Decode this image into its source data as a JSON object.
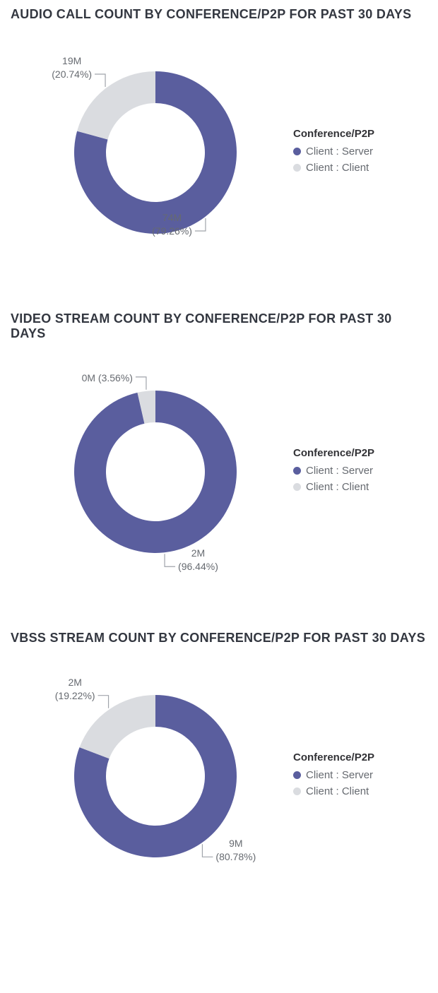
{
  "colors": {
    "primary": "#5A5E9E",
    "secondary": "#DADCE0"
  },
  "legend": {
    "title": "Conference/P2P",
    "items": [
      {
        "label": "Client : Server",
        "color_key": "primary"
      },
      {
        "label": "Client : Client",
        "color_key": "secondary"
      }
    ]
  },
  "charts": [
    {
      "title": "AUDIO CALL COUNT BY CONFERENCE/P2P FOR PAST 30 DAYS",
      "series": [
        {
          "name": "Client : Server",
          "value_label": "74M",
          "percent_label": "(79.26%)",
          "percent": 79.26,
          "color_key": "primary",
          "label_pos": "left-bottom"
        },
        {
          "name": "Client : Client",
          "value_label": "19M",
          "percent_label": "(20.74%)",
          "percent": 20.74,
          "color_key": "secondary",
          "label_pos": "left-top"
        }
      ]
    },
    {
      "title": "VIDEO STREAM COUNT BY CONFERENCE/P2P FOR PAST 30 DAYS",
      "series": [
        {
          "name": "Client : Server",
          "value_label": "2M",
          "percent_label": "(96.44%)",
          "percent": 96.44,
          "color_key": "primary",
          "label_pos": "right-bottom"
        },
        {
          "name": "Client : Client",
          "value_label": "0M (3.56%)",
          "percent_label": "",
          "percent": 3.56,
          "color_key": "secondary",
          "label_pos": "left-top"
        }
      ]
    },
    {
      "title": "VBSS STREAM COUNT BY CONFERENCE/P2P FOR PAST 30 DAYS",
      "series": [
        {
          "name": "Client : Server",
          "value_label": "9M",
          "percent_label": "(80.78%)",
          "percent": 80.78,
          "color_key": "primary",
          "label_pos": "right-bottom"
        },
        {
          "name": "Client : Client",
          "value_label": "2M",
          "percent_label": "(19.22%)",
          "percent": 19.22,
          "color_key": "secondary",
          "label_pos": "left-top"
        }
      ]
    }
  ],
  "chart_data": [
    {
      "type": "pie",
      "title": "AUDIO CALL COUNT BY CONFERENCE/P2P FOR PAST 30 DAYS",
      "legend_title": "Conference/P2P",
      "series": [
        {
          "name": "Client : Server",
          "value_millions": 74,
          "percent": 79.26
        },
        {
          "name": "Client : Client",
          "value_millions": 19,
          "percent": 20.74
        }
      ]
    },
    {
      "type": "pie",
      "title": "VIDEO STREAM COUNT BY CONFERENCE/P2P FOR PAST 30 DAYS",
      "legend_title": "Conference/P2P",
      "series": [
        {
          "name": "Client : Server",
          "value_millions": 2,
          "percent": 96.44
        },
        {
          "name": "Client : Client",
          "value_millions": 0,
          "percent": 3.56
        }
      ]
    },
    {
      "type": "pie",
      "title": "VBSS STREAM COUNT BY CONFERENCE/P2P FOR PAST 30 DAYS",
      "legend_title": "Conference/P2P",
      "series": [
        {
          "name": "Client : Server",
          "value_millions": 9,
          "percent": 80.78
        },
        {
          "name": "Client : Client",
          "value_millions": 2,
          "percent": 19.22
        }
      ]
    }
  ]
}
